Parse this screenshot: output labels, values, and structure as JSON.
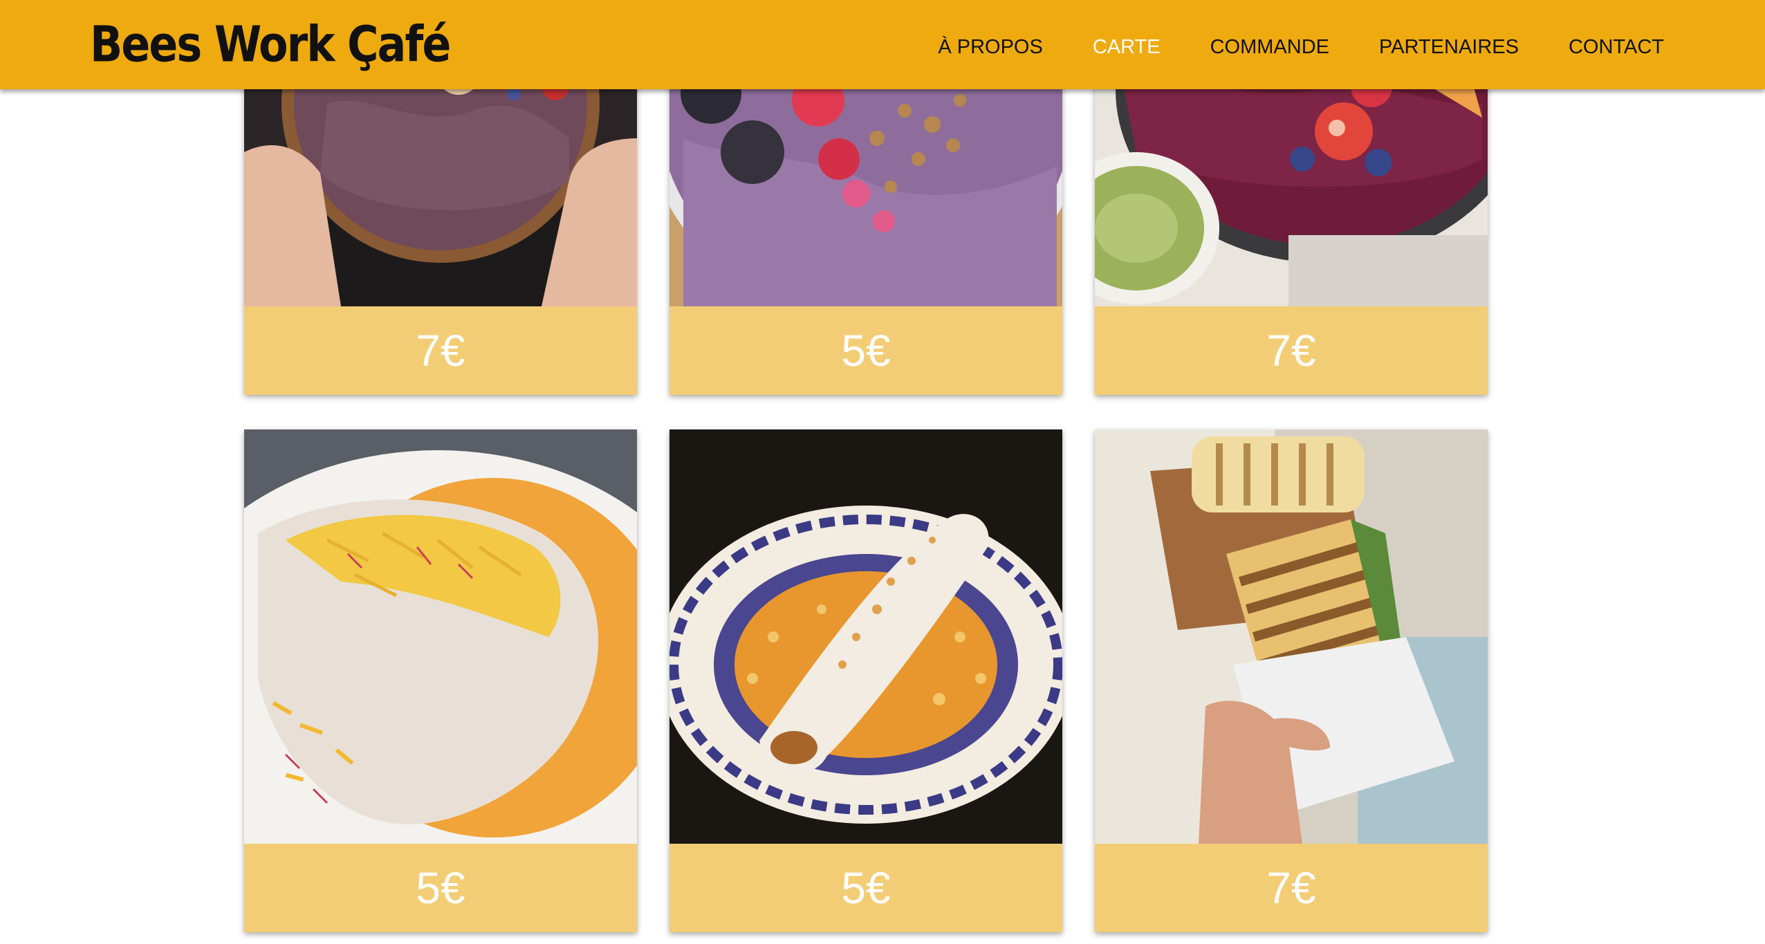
{
  "header": {
    "logo_text": "Bees Work Çafé",
    "nav": [
      {
        "label": "À PROPOS",
        "active": false
      },
      {
        "label": "CARTE",
        "active": true
      },
      {
        "label": "COMMANDE",
        "active": false
      },
      {
        "label": "PARTENAIRES",
        "active": false
      },
      {
        "label": "CONTACT",
        "active": false
      }
    ]
  },
  "colors": {
    "header_bg": "#eeaa0f",
    "card_bar": "#f3cd76",
    "price_text": "#ffffff",
    "active_nav": "#ffffff",
    "nav_text": "#111111"
  },
  "menu": {
    "items": [
      {
        "price": "7€",
        "photo": "acai-bowl-hands-icon"
      },
      {
        "price": "5€",
        "photo": "acai-bowl-berries-icon"
      },
      {
        "price": "7€",
        "photo": "acai-bowl-fruit-icon"
      },
      {
        "price": "5€",
        "photo": "tapioca-cheese-icon"
      },
      {
        "price": "5€",
        "photo": "tapioca-caramel-icon"
      },
      {
        "price": "7€",
        "photo": "panini-sandwich-icon"
      }
    ]
  }
}
